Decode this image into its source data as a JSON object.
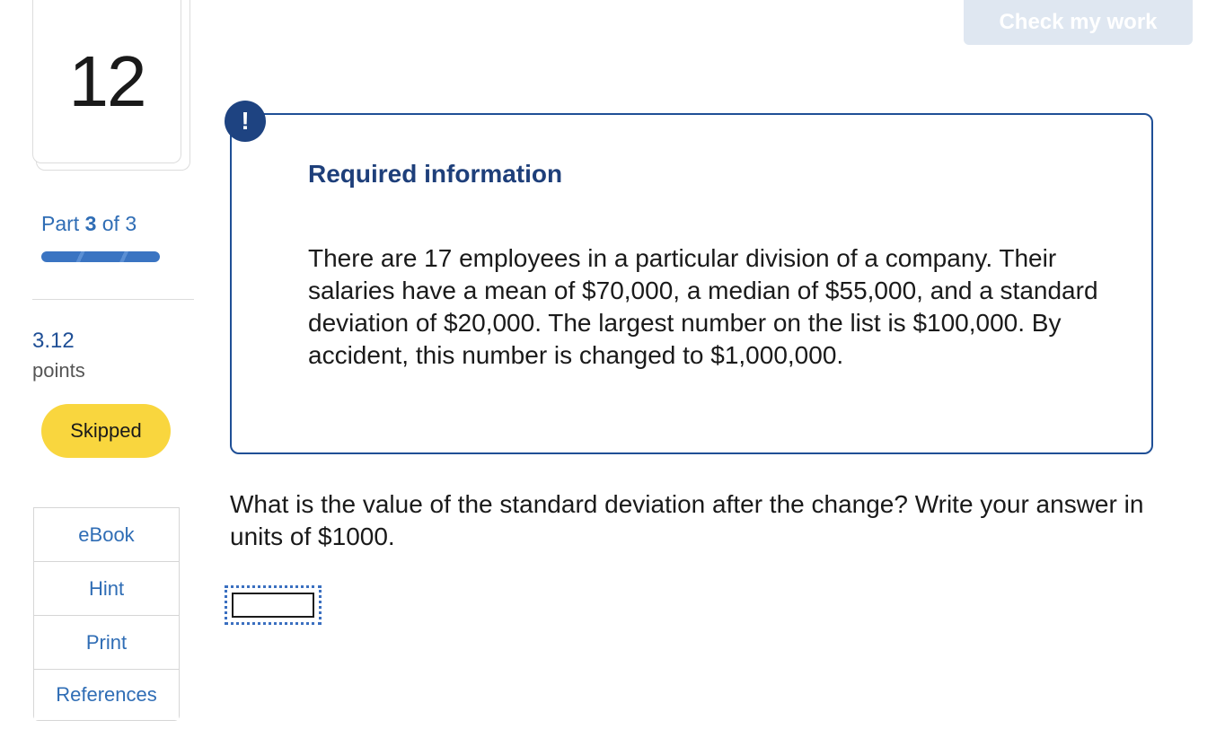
{
  "question": {
    "number": "12",
    "part_current": "3",
    "part_word": "Part",
    "part_of": "of 3",
    "part_progress": 1.0,
    "points_value": "3.12",
    "points_label": "points",
    "status": "Skipped"
  },
  "tools": [
    {
      "label": "eBook"
    },
    {
      "label": "Hint"
    },
    {
      "label": "Print"
    },
    {
      "label": "References"
    }
  ],
  "header": {
    "check_label": "Check my work"
  },
  "required_info": {
    "icon": "!",
    "title": "Required information",
    "body": "There are 17 employees in a particular division of a company. Their salaries have a mean of $70,000, a median of $55,000, and a standard deviation of $20,000. The largest number on the list is $100,000. By accident, this number is changed to $1,000,000."
  },
  "prompt": {
    "text": "What is the value of the standard deviation after the change?  Write your answer in units of $1000."
  },
  "answer": {
    "value": "",
    "placeholder": ""
  },
  "colors": {
    "accent": "#1f4f96",
    "link": "#2f6db5",
    "badge": "#f9d63e",
    "check_button_bg": "#dfe7f1"
  }
}
